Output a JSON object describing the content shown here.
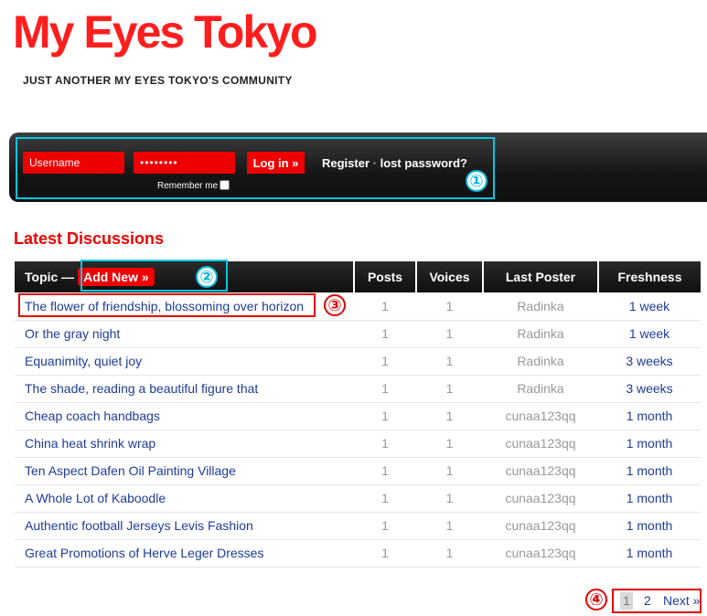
{
  "site": {
    "logo": "My Eyes Tokyo",
    "tagline": "JUST ANOTHER MY EYES TOKYO'S COMMUNITY"
  },
  "login": {
    "username_placeholder": "Username",
    "password_value": "••••••••",
    "login_button": "Log in »",
    "register_link": "Register",
    "separator": "·",
    "lost_password_link": "lost password?",
    "remember_label": "Remember me"
  },
  "annotations": [
    "①",
    "②",
    "③",
    "④"
  ],
  "main": {
    "title": "Latest Discussions",
    "columns": {
      "topic": "Topic —",
      "add_new": "Add New »",
      "posts": "Posts",
      "voices": "Voices",
      "last_poster": "Last Poster",
      "freshness": "Freshness"
    },
    "rows": [
      {
        "topic": "The flower of friendship, blossoming over horizon",
        "posts": "1",
        "voices": "1",
        "last_poster": "Radinka",
        "freshness": "1 week"
      },
      {
        "topic": "Or the gray night",
        "posts": "1",
        "voices": "1",
        "last_poster": "Radinka",
        "freshness": "1 week"
      },
      {
        "topic": "Equanimity, quiet joy",
        "posts": "1",
        "voices": "1",
        "last_poster": "Radinka",
        "freshness": "3 weeks"
      },
      {
        "topic": "The shade, reading a beautiful figure that",
        "posts": "1",
        "voices": "1",
        "last_poster": "Radinka",
        "freshness": "3 weeks"
      },
      {
        "topic": "Cheap coach handbags",
        "posts": "1",
        "voices": "1",
        "last_poster": "cunaa123qq",
        "freshness": "1 month"
      },
      {
        "topic": "China heat shrink wrap",
        "posts": "1",
        "voices": "1",
        "last_poster": "cunaa123qq",
        "freshness": "1 month"
      },
      {
        "topic": "Ten Aspect Dafen Oil Painting Village",
        "posts": "1",
        "voices": "1",
        "last_poster": "cunaa123qq",
        "freshness": "1 month"
      },
      {
        "topic": "A Whole Lot of Kaboodle",
        "posts": "1",
        "voices": "1",
        "last_poster": "cunaa123qq",
        "freshness": "1 month"
      },
      {
        "topic": "Authentic football Jerseys Levis Fashion",
        "posts": "1",
        "voices": "1",
        "last_poster": "cunaa123qq",
        "freshness": "1 month"
      },
      {
        "topic": "Great Promotions of Herve Leger Dresses",
        "posts": "1",
        "voices": "1",
        "last_poster": "cunaa123qq",
        "freshness": "1 month"
      }
    ]
  },
  "pagination": {
    "current": "1",
    "page2": "2",
    "next": "Next »"
  },
  "colors": {
    "brand_red": "#ee0000",
    "link_blue": "#1d3c9a",
    "annotation_cyan": "#00c8e6",
    "annotation_red": "#e00000"
  }
}
